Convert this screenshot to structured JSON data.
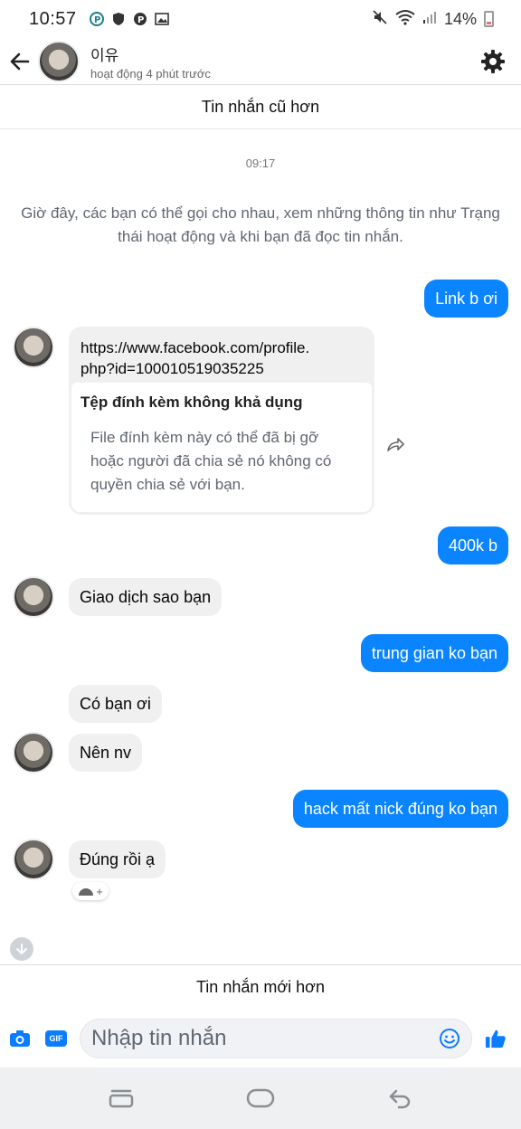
{
  "status_bar": {
    "time": "10:57",
    "battery": "14%",
    "left_icons": [
      "p-circle-icon",
      "shield-icon",
      "p-icon",
      "image-icon"
    ],
    "right_icons": [
      "mute-icon",
      "wifi-icon",
      "signal-icon",
      "battery-icon"
    ]
  },
  "header": {
    "contact_name": "이유",
    "contact_status": "hoạt động 4 phút trước"
  },
  "older_messages_label": "Tin nhắn cũ hơn",
  "newer_messages_label": "Tin nhắn mới hơn",
  "chat": {
    "timestamp": "09:17",
    "system_message": "Giờ đây, các bạn có thể gọi cho nhau, xem những thông tin như Trạng thái hoạt động và khi bạn đã đọc tin nhắn.",
    "messages": [
      {
        "direction": "outgoing",
        "text": "Link b ơi"
      },
      {
        "direction": "incoming",
        "type": "attachment"
      },
      {
        "direction": "outgoing",
        "text": "400k b"
      },
      {
        "direction": "incoming",
        "text": "Giao dịch sao bạn"
      },
      {
        "direction": "outgoing",
        "text": "trung gian ko bạn"
      },
      {
        "direction": "incoming",
        "text": "Có bạn ơi"
      },
      {
        "direction": "incoming",
        "text": "Nên nv"
      },
      {
        "direction": "outgoing",
        "text": "hack mất nick đúng ko bạn"
      },
      {
        "direction": "incoming",
        "text": "Đúng rồi ạ"
      }
    ],
    "attachment": {
      "url": "https://www.facebook.com/profile.\nphp?id=100010519035225",
      "title": "Tệp đính kèm không khả dụng",
      "body": "File đính kèm này có thể đã bị gỡ\nhoặc người đã chia sẻ nó không có\nquyền chia sẻ với bạn."
    },
    "reaction_plus": "+"
  },
  "composer": {
    "placeholder": "Nhập tin nhắn",
    "gif_label": "GIF"
  },
  "colors": {
    "outgoing_bubble": "#0a84ff",
    "incoming_bubble": "#f0f0f0",
    "accent": "#0a7cff"
  }
}
